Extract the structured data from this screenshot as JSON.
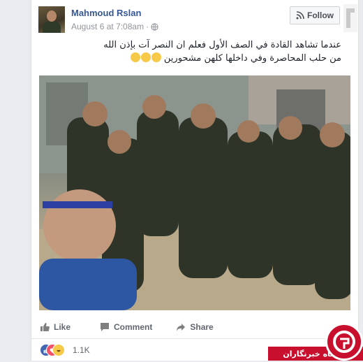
{
  "post": {
    "author": "Mahmoud Rslan",
    "timestamp": "August 6 at 7:08am",
    "follow_label": "Follow",
    "text_line1": "عندما تشاهد القادة في الصف الأول فعلم ان النصر آت بإذن الله",
    "text_line2": "من حلب المحاصرة وفي داخلها كلهن مشحورين",
    "emoji_count": 3
  },
  "actions": {
    "like": "Like",
    "comment": "Comment",
    "share": "Share"
  },
  "reactions": {
    "count": "1.1K",
    "types": [
      "like-icon",
      "love-icon",
      "haha-icon"
    ]
  },
  "watermark": {
    "text": "باشگاه خبرنگاران"
  },
  "colors": {
    "link": "#365899",
    "meta": "#90949c",
    "like_blue": "#4267b2",
    "love_red": "#f25268",
    "haha_yellow": "#f7c948",
    "watermark_red": "#c8102e"
  }
}
